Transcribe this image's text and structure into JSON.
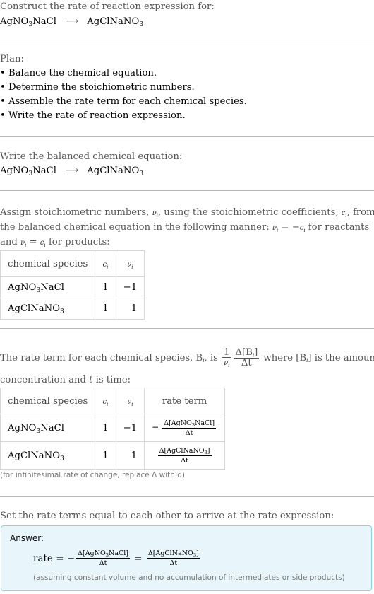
{
  "header": {
    "prompt": "Construct the rate of reaction expression for:",
    "reaction": {
      "reactant_main": "AgNO",
      "reactant_sub": "3",
      "reactant_tail": "NaCl",
      "arrow": "⟶",
      "product_main": "AgClNaNO",
      "product_sub": "3"
    }
  },
  "plan": {
    "title": "Plan:",
    "steps": [
      "• Balance the chemical equation.",
      "• Determine the stoichiometric numbers.",
      "• Assemble the rate term for each chemical species.",
      "• Write the rate of reaction expression."
    ]
  },
  "balanced": {
    "title": "Write the balanced chemical equation:"
  },
  "stoich": {
    "line1a": "Assign stoichiometric numbers, ",
    "nu_i": "ν",
    "i": "i",
    "line1b": ", using the stoichiometric coefficients, ",
    "c_i": "c",
    "line1c": ", from",
    "line2a": "the balanced chemical equation in the following manner: ",
    "line2b": " = −",
    "line2c": " for reactants",
    "line3a": "and ",
    "line3b": " = ",
    "line3c": " for products:",
    "table": {
      "headers": [
        "chemical species",
        "c",
        "ν"
      ],
      "rows": [
        {
          "species_main": "AgNO",
          "species_sub": "3",
          "species_tail": "NaCl",
          "c": "1",
          "nu": "−1"
        },
        {
          "species_main": "AgClNaNO",
          "species_sub": "3",
          "species_tail": "",
          "c": "1",
          "nu": "1"
        }
      ]
    }
  },
  "rate_term": {
    "line1a": "The rate term for each chemical species, B",
    "line1b": ", is ",
    "frac1_num": "1",
    "frac2_num": "Δ[B",
    "frac2_num_end": "]",
    "frac2_den": "Δt",
    "line1c": " where [B",
    "line1d": "] is the amount",
    "line2a": "concentration and ",
    "t": "t",
    "line2b": " is time:",
    "table": {
      "headers": [
        "chemical species",
        "c",
        "ν",
        "rate term"
      ],
      "rows": [
        {
          "species_main": "AgNO",
          "species_sub": "3",
          "species_tail": "NaCl",
          "c": "1",
          "nu": "−1",
          "sign": "−",
          "term_num": "Δ[AgNO",
          "term_sub": "3",
          "term_tail": "NaCl]",
          "term_den": "Δt"
        },
        {
          "species_main": "AgClNaNO",
          "species_sub": "3",
          "species_tail": "",
          "c": "1",
          "nu": "1",
          "sign": "",
          "term_num": "Δ[AgClNaNO",
          "term_sub": "3",
          "term_tail": "]",
          "term_den": "Δt"
        }
      ]
    },
    "note": "(for infinitesimal rate of change, replace Δ with d)"
  },
  "final": {
    "title": "Set the rate terms equal to each other to arrive at the rate expression:",
    "answer_label": "Answer:",
    "rate": "rate",
    "eq": " = ",
    "minus": "−",
    "eq2": " = ",
    "term1_num": "Δ[AgNO",
    "term1_sub": "3",
    "term1_tail": "NaCl]",
    "term2_num": "Δ[AgClNaNO",
    "term2_sub": "3",
    "term2_tail": "]",
    "den": "Δt",
    "assumption": "(assuming constant volume and no accumulation of intermediates or side products)"
  }
}
